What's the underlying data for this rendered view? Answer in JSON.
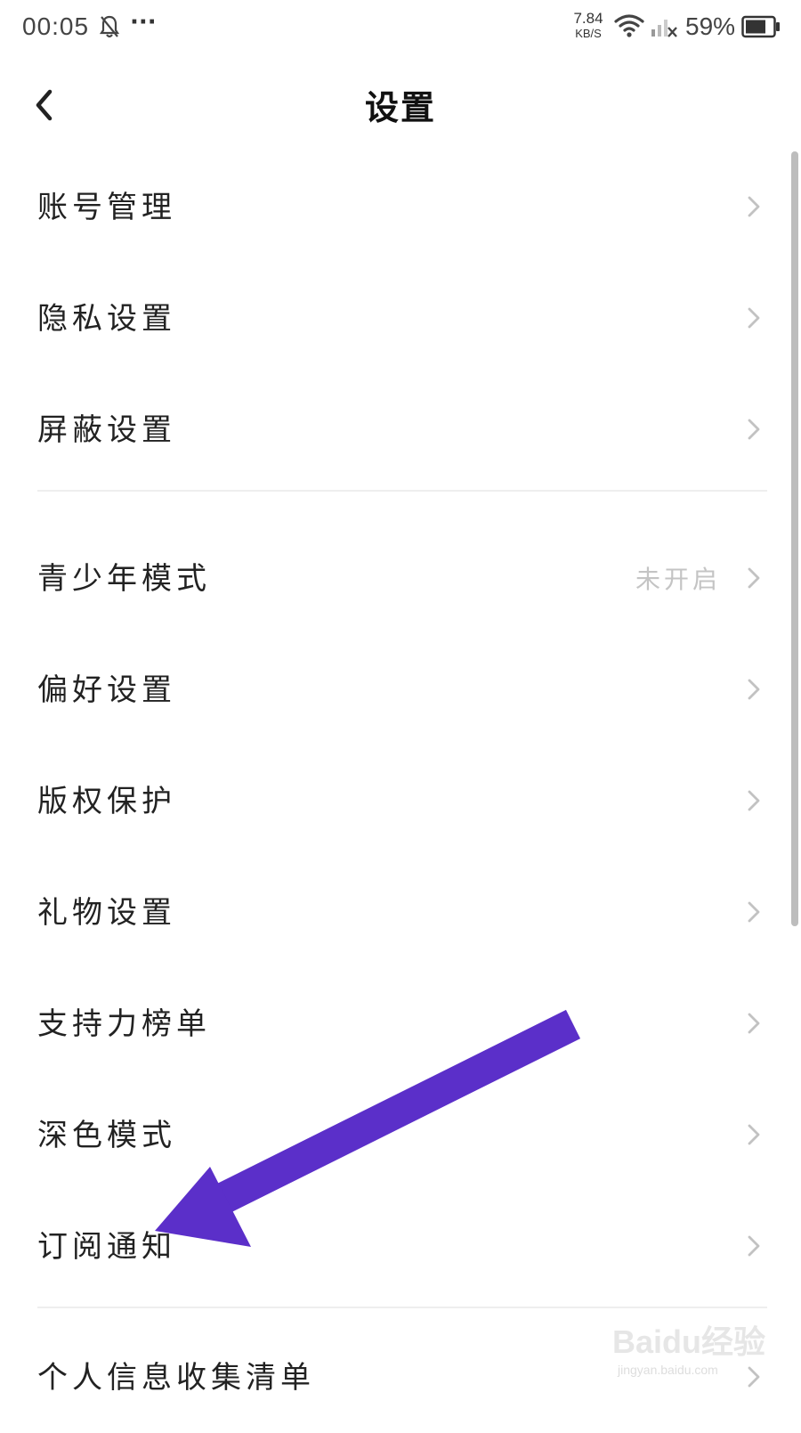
{
  "status_bar": {
    "time": "00:05",
    "more": "···",
    "net_speed_value": "7.84",
    "net_speed_unit": "KB/S",
    "battery_percent": "59%"
  },
  "header": {
    "title": "设置"
  },
  "settings": {
    "group1": [
      {
        "label": "账号管理"
      },
      {
        "label": "隐私设置"
      },
      {
        "label": "屏蔽设置"
      }
    ],
    "group2": [
      {
        "label": "青少年模式",
        "value": "未开启"
      },
      {
        "label": "偏好设置"
      },
      {
        "label": "版权保护"
      },
      {
        "label": "礼物设置"
      },
      {
        "label": "支持力榜单"
      },
      {
        "label": "深色模式"
      },
      {
        "label": "订阅通知"
      }
    ],
    "group3": [
      {
        "label": "个人信息收集清单"
      }
    ]
  },
  "annotation": {
    "arrow_color": "#5b2fc9"
  },
  "watermark": {
    "logo": "Baidu经验",
    "url": "jingyan.baidu.com"
  },
  "colors": {
    "background": "#ffffff",
    "text": "#222222",
    "secondary_text": "#c4c4c4",
    "divider": "#eeeeee"
  }
}
